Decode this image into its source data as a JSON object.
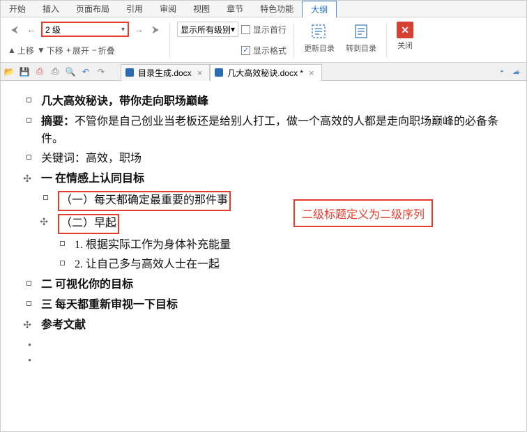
{
  "menu": [
    "开始",
    "插入",
    "页面布局",
    "引用",
    "审阅",
    "视图",
    "章节",
    "特色功能",
    "大纲"
  ],
  "menu_active_index": 8,
  "ribbon": {
    "level_value": "2 级",
    "up": "上移",
    "down": "下移",
    "expand": "展开",
    "collapse": "折叠",
    "show_levels": "显示所有级别",
    "show_first_line": "显示首行",
    "show_format": "显示格式",
    "show_format_checked": true,
    "update_toc": "更新目录",
    "goto_toc": "转到目录",
    "close": "关闭"
  },
  "tabs": [
    {
      "title": "目录生成.docx",
      "dirty": false,
      "active": false
    },
    {
      "title": "几大高效秘诀.docx",
      "dirty": true,
      "active": true
    }
  ],
  "outline": [
    {
      "marker": "square",
      "indent": 0,
      "bold": true,
      "text": "几大高效秘诀，带你走向职场巅峰"
    },
    {
      "marker": "square",
      "indent": 0,
      "segments": [
        {
          "t": "摘要：",
          "bold": true
        },
        {
          "t": "不管你是自己创业当老板还是给别人打工，做一个高效的人都是走向职场巅峰的必备条件。"
        }
      ]
    },
    {
      "marker": "square",
      "indent": 0,
      "text": "关键词：高效，职场"
    },
    {
      "marker": "plus",
      "indent": 0,
      "bold": true,
      "text": "一  在情感上认同目标"
    },
    {
      "marker": "square",
      "indent": 1,
      "highlight": true,
      "text": "（一）每天都确定最重要的那件事"
    },
    {
      "marker": "plus",
      "indent": 1,
      "highlight": true,
      "text": "（二）早起"
    },
    {
      "marker": "square",
      "indent": 2,
      "text": "1. 根据实际工作为身体补充能量"
    },
    {
      "marker": "square",
      "indent": 2,
      "text": "2. 让自己多与高效人士在一起"
    },
    {
      "marker": "square",
      "indent": 0,
      "bold": true,
      "text": "二  可视化你的目标"
    },
    {
      "marker": "square",
      "indent": 0,
      "bold": true,
      "text": "三  每天都重新审视一下目标"
    },
    {
      "marker": "plus",
      "indent": 0,
      "bold": true,
      "text": "参考文献"
    },
    {
      "marker": "dot",
      "indent": 0,
      "text": ""
    },
    {
      "marker": "dot",
      "indent": 0,
      "text": ""
    }
  ],
  "annotation": "二级标题定义为二级序列"
}
